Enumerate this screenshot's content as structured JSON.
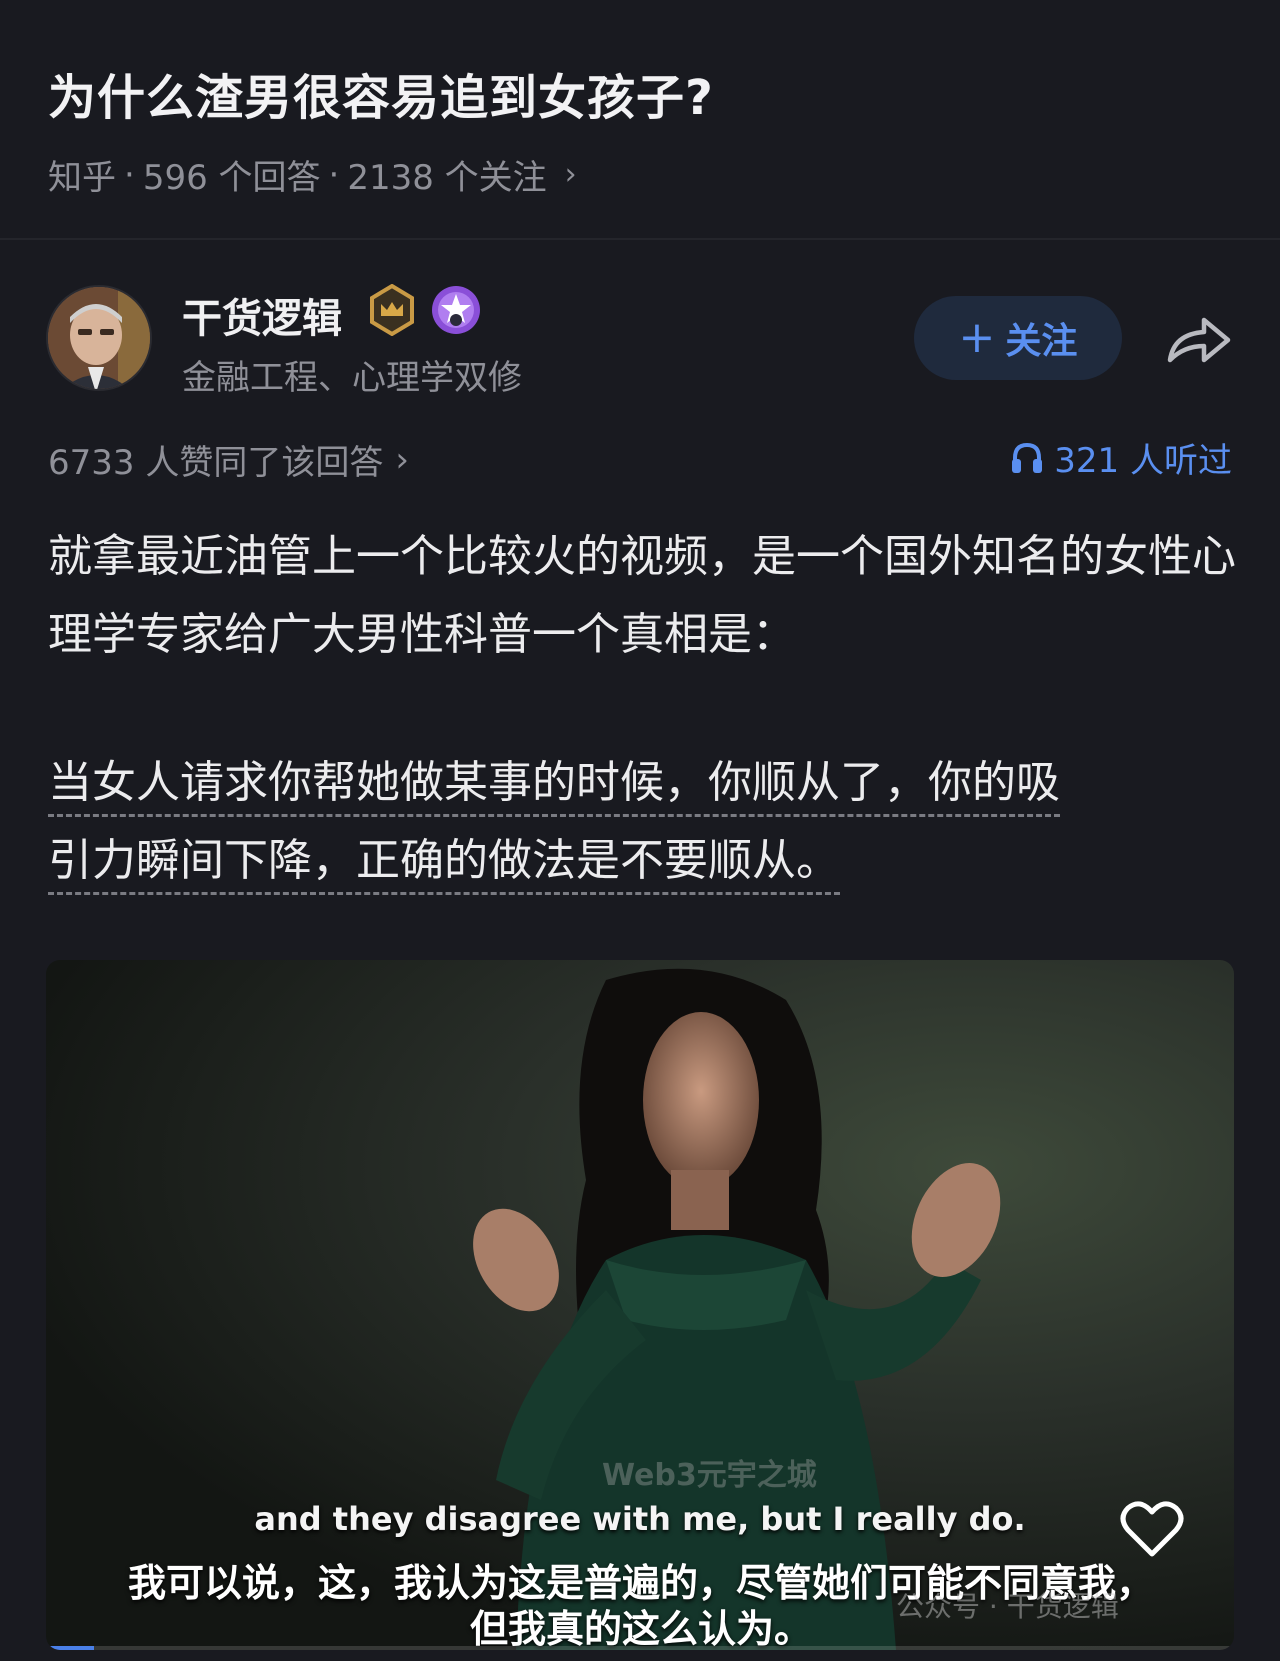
{
  "question": {
    "title": "为什么渣男很容易追到女孩子?",
    "source": "知乎",
    "sep": "·",
    "answers": "596 个回答",
    "followers": "2138 个关注",
    "chevron": "›"
  },
  "author": {
    "name": "干货逻辑",
    "bio": "金融工程、心理学双修",
    "avatar_icon": "avatar-portrait",
    "badge1_icon": "crown-badge-icon",
    "badge2_icon": "star-badge-icon"
  },
  "actions": {
    "follow_plus": "+",
    "follow_label": "关注",
    "share_icon": "share-icon"
  },
  "stats": {
    "agree": "6733 人赞同了该回答",
    "chevron": "›",
    "listen": "321 人听过",
    "listen_icon": "headphones-icon"
  },
  "content": {
    "para1": "就拿最近油管上一个比较火的视频，是一个国外知名的女性心理学专家给广大男性科普一个真相是：",
    "para2_line1": "当女人请求你帮她做某事的时候，你顺从了，你的吸",
    "para2_line2": "引力瞬间下降，正确的做法是不要顺从。"
  },
  "video": {
    "watermark_top": "Web3元宇之城",
    "subtitle_en": "and they disagree with me, but I really do.",
    "subtitle_zh_line1": "我可以说，这，我认为这是普遍的，尽管她们可能不同意我，",
    "subtitle_zh_line2": "但我真的这么认为。",
    "watermark_bottom": "公众号 · 干货逻辑",
    "like_icon": "heart-icon",
    "progress": 0.04
  },
  "colors": {
    "background": "#191a20",
    "accent": "#5a8ff0",
    "muted": "#8f9098"
  }
}
